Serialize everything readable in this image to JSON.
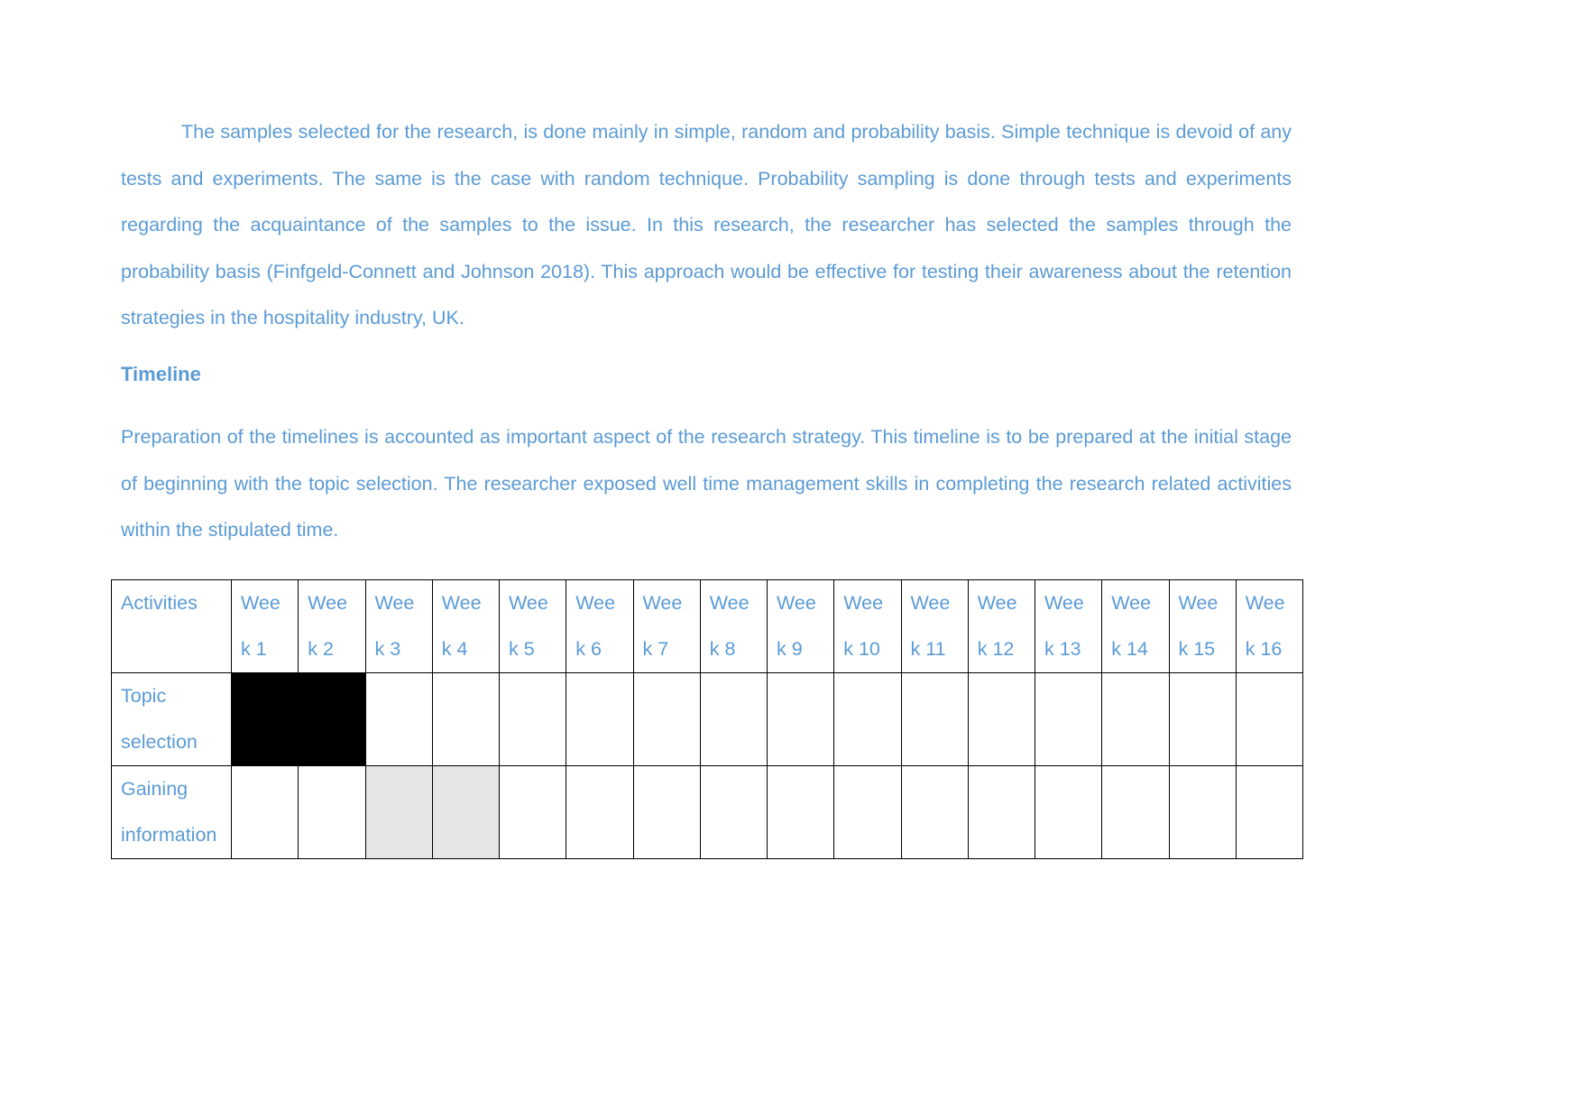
{
  "document": {
    "paragraph_1": "The samples selected for the research, is done mainly in simple, random and probability basis. Simple technique is devoid of any tests and experiments. The same is the case with random technique. Probability sampling is done through tests and experiments regarding the acquaintance of the samples to the issue. In this research, the researcher has selected the samples through the probability basis (Finfgeld-Connett and Johnson 2018). This approach would be effective for testing their awareness about the retention strategies in the hospitality industry, UK.",
    "heading": "Timeline",
    "paragraph_2": "Preparation of the timelines is accounted as important aspect of the research strategy. This timeline is to be prepared at the initial stage of beginning with the topic selection. The researcher exposed well time management skills in completing the research related activities within the stipulated time."
  },
  "timeline_table": {
    "header_activity": "Activities",
    "week_line1": "Wee",
    "weeks_line2": [
      "k 1",
      "k 2",
      "k 3",
      "k 4",
      "k 5",
      "k 6",
      "k 7",
      "k 8",
      "k 9",
      "k 10",
      "k 11",
      "k 12",
      "k 13",
      "k 14",
      "k 15",
      "k 16"
    ],
    "rows": [
      {
        "activity_line1": "Topic",
        "activity_line2": "selection",
        "fill": "black",
        "active_weeks": [
          1,
          2
        ]
      },
      {
        "activity_line1": "Gaining",
        "activity_line2": "information",
        "fill": "gray",
        "active_weeks": [
          3,
          4
        ]
      }
    ],
    "colors": {
      "text": "#5b9bd5",
      "black_fill": "#000000",
      "gray_fill": "#e6e6e6"
    }
  }
}
